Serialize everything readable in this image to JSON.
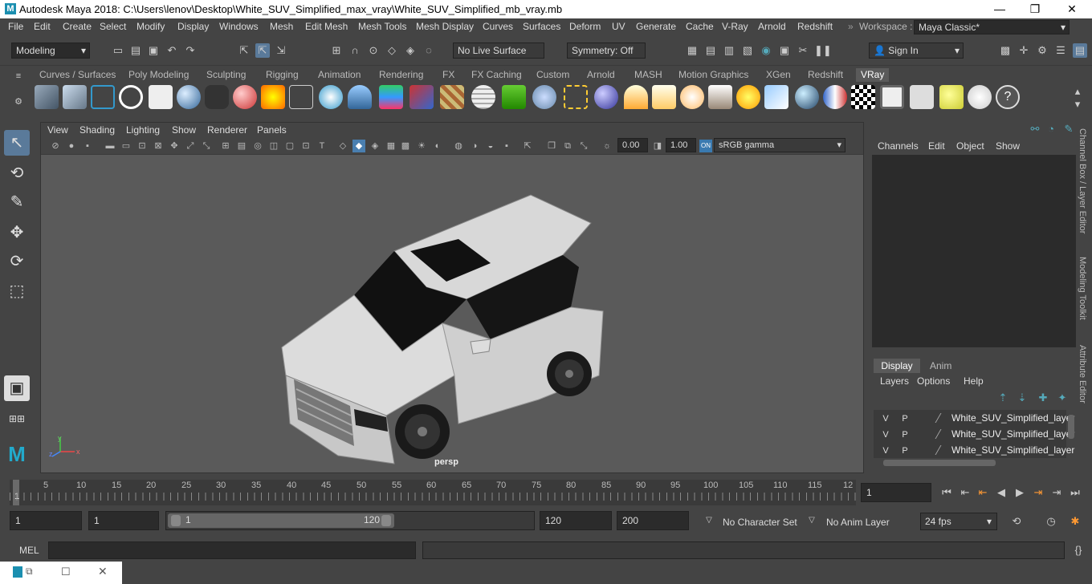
{
  "window": {
    "logo": "M",
    "title": "Autodesk Maya 2018: C:\\Users\\lenov\\Desktop\\White_SUV_Simplified_max_vray\\White_SUV_Simplified_mb_vray.mb",
    "min": "—",
    "max": "❐",
    "close": "✕"
  },
  "menubar": {
    "items": [
      "File",
      "Edit",
      "Create",
      "Select",
      "Modify",
      "Display",
      "Windows",
      "Mesh",
      "Edit Mesh",
      "Mesh Tools",
      "Mesh Display",
      "Curves",
      "Surfaces",
      "Deform",
      "UV",
      "Generate",
      "Cache",
      "V-Ray",
      "Arnold",
      "Redshift"
    ],
    "workspace_label": "Workspace :",
    "workspace_value": "Maya Classic*"
  },
  "statusline": {
    "menuset": "Modeling",
    "live_surface": "No Live Surface",
    "symmetry": "Symmetry: Off",
    "sign_in": "Sign In"
  },
  "shelf": {
    "tabs": [
      "Curves / Surfaces",
      "Poly Modeling",
      "Sculpting",
      "Rigging",
      "Animation",
      "Rendering",
      "FX",
      "FX Caching",
      "Custom",
      "Arnold",
      "MASH",
      "Motion Graphics",
      "XGen",
      "Redshift",
      "VRay"
    ],
    "active_tab": "VRay"
  },
  "viewport": {
    "menu": [
      "View",
      "Shading",
      "Lighting",
      "Show",
      "Renderer",
      "Panels"
    ],
    "exposure": "0.00",
    "gamma": "1.00",
    "colorspace": "sRGB gamma",
    "camera": "persp",
    "axis_x": "x",
    "axis_y": "y",
    "axis_z": "z"
  },
  "channelbox": {
    "menu": [
      "Channels",
      "Edit",
      "Object",
      "Show"
    ]
  },
  "layereditor": {
    "tabs": [
      "Display",
      "Anim"
    ],
    "menu": [
      "Layers",
      "Options",
      "Help"
    ],
    "layers": [
      {
        "v": "V",
        "p": "P",
        "name": "White_SUV_Simplified_layer"
      },
      {
        "v": "V",
        "p": "P",
        "name": "White_SUV_Simplified_layer"
      },
      {
        "v": "V",
        "p": "P",
        "name": "White_SUV_Simplified_layer"
      }
    ]
  },
  "sidetabs": [
    "Channel Box / Layer Editor",
    "Modeling Toolkit",
    "Attribute Editor"
  ],
  "timeline": {
    "ticks": [
      "1",
      "5",
      "10",
      "15",
      "20",
      "25",
      "30",
      "35",
      "40",
      "45",
      "50",
      "55",
      "60",
      "65",
      "70",
      "75",
      "80",
      "85",
      "90",
      "95",
      "100",
      "105",
      "110",
      "115",
      "12"
    ],
    "current_frame": "1"
  },
  "range": {
    "start": "1",
    "playback_start": "1",
    "slider_start": "1",
    "slider_end": "120",
    "playback_end": "120",
    "end": "200",
    "character_set": "No Character Set",
    "anim_layer": "No Anim Layer",
    "fps": "24 fps"
  },
  "cmdline": {
    "label": "MEL"
  }
}
